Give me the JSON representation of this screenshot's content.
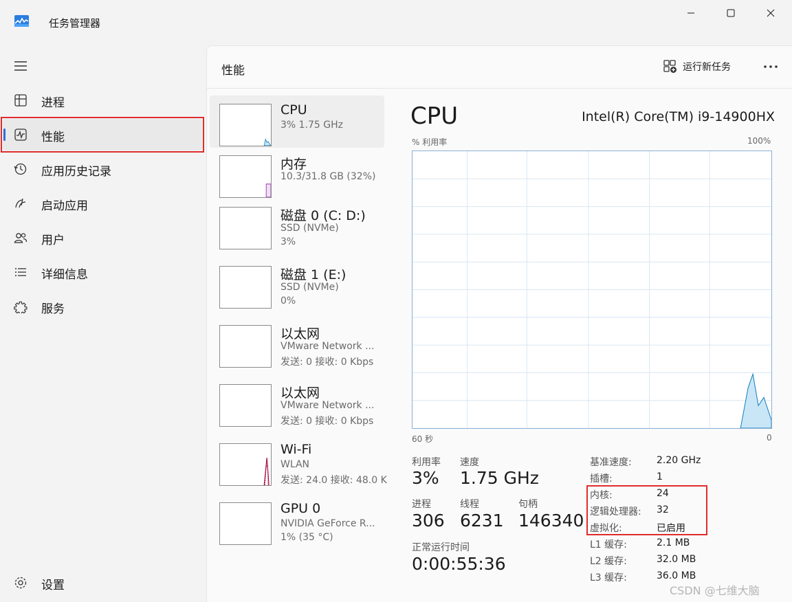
{
  "window": {
    "title": "任务管理器"
  },
  "sidebar": {
    "items": [
      {
        "label": "进程",
        "icon": "processes-icon"
      },
      {
        "label": "性能",
        "icon": "performance-icon",
        "active": true
      },
      {
        "label": "应用历史记录",
        "icon": "history-icon"
      },
      {
        "label": "启动应用",
        "icon": "startup-icon"
      },
      {
        "label": "用户",
        "icon": "users-icon"
      },
      {
        "label": "详细信息",
        "icon": "details-icon"
      },
      {
        "label": "服务",
        "icon": "services-icon"
      }
    ],
    "settings_label": "设置"
  },
  "header": {
    "title": "性能",
    "run_task_label": "运行新任务"
  },
  "devices": [
    {
      "name": "CPU",
      "sub1": "3% 1.75 GHz",
      "sub2": ""
    },
    {
      "name": "内存",
      "sub1": "10.3/31.8 GB (32%)",
      "sub2": ""
    },
    {
      "name": "磁盘 0 (C: D:)",
      "sub1": "SSD (NVMe)",
      "sub2": "3%"
    },
    {
      "name": "磁盘 1 (E:)",
      "sub1": "SSD (NVMe)",
      "sub2": "0%"
    },
    {
      "name": "以太网",
      "sub1": "VMware Network ...",
      "sub2": "发送: 0 接收: 0 Kbps"
    },
    {
      "name": "以太网",
      "sub1": "VMware Network ...",
      "sub2": "发送: 0 接收: 0 Kbps"
    },
    {
      "name": "Wi-Fi",
      "sub1": "WLAN",
      "sub2": "发送: 24.0 接收: 48.0 K"
    },
    {
      "name": "GPU 0",
      "sub1": "NVIDIA GeForce R...",
      "sub2": "1% (35 °C)"
    }
  ],
  "detail": {
    "title": "CPU",
    "model": "Intel(R) Core(TM) i9-14900HX",
    "graph_ylabel": "% 利用率",
    "graph_ymax": "100%",
    "graph_xleft": "60 秒",
    "graph_xright": "0",
    "stats": {
      "util_label": "利用率",
      "util_value": "3%",
      "speed_label": "速度",
      "speed_value": "1.75 GHz",
      "proc_label": "进程",
      "proc_value": "306",
      "thread_label": "线程",
      "thread_value": "6231",
      "handle_label": "句柄",
      "handle_value": "146340",
      "uptime_label": "正常运行时间",
      "uptime_value": "0:00:55:36"
    },
    "specs": [
      {
        "label": "基准速度:",
        "value": "2.20 GHz"
      },
      {
        "label": "插槽:",
        "value": "1"
      },
      {
        "label": "内核:",
        "value": "24"
      },
      {
        "label": "逻辑处理器:",
        "value": "32"
      },
      {
        "label": "虚拟化:",
        "value": "已启用"
      },
      {
        "label": "L1 缓存:",
        "value": "2.1 MB"
      },
      {
        "label": "L2 缓存:",
        "value": "32.0 MB"
      },
      {
        "label": "L3 缓存:",
        "value": "36.0 MB"
      }
    ]
  },
  "watermark": "CSDN @七维大脑",
  "colors": {
    "accent": "#2f6fd6",
    "highlight": "#e02c2c",
    "cpu_graph": "#117dbb",
    "mem_graph": "#8b12ae",
    "wifi_graph": "#a7114b"
  }
}
